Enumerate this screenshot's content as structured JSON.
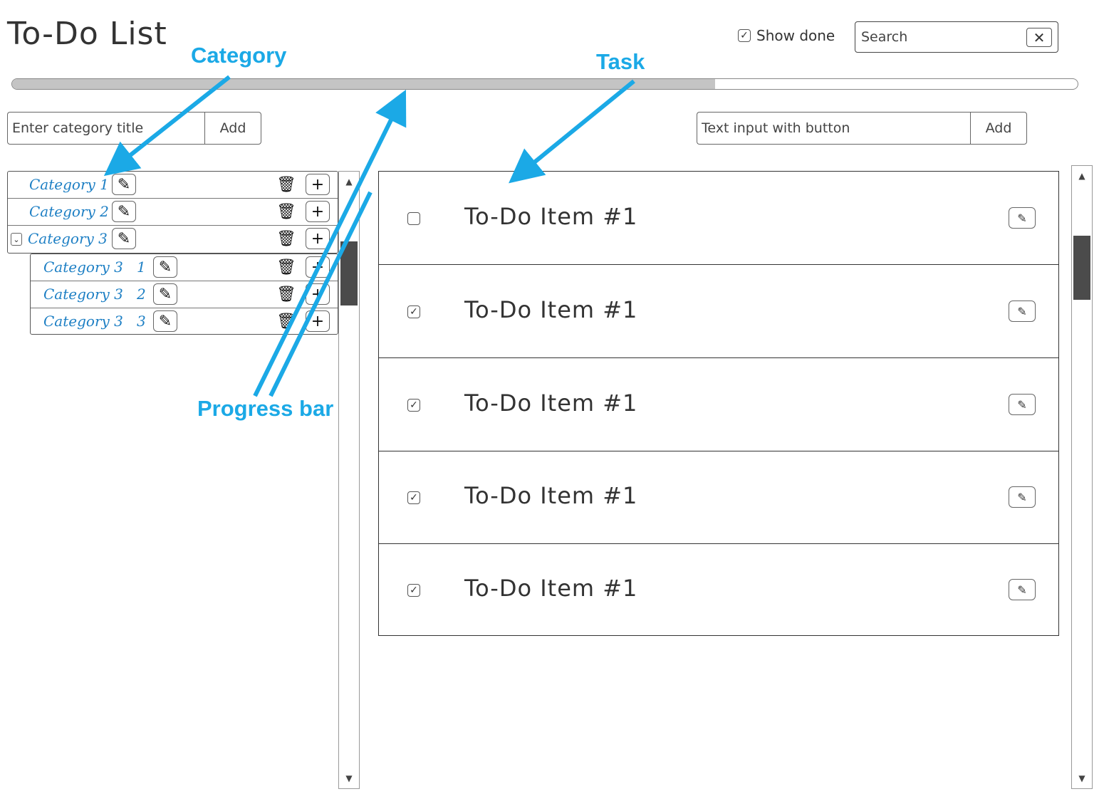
{
  "app": {
    "title": "To-Do List"
  },
  "header": {
    "show_done_label": "Show done",
    "show_done_checked": true,
    "search_placeholder": "Search",
    "search_clear_icon": "close-icon"
  },
  "progress": {
    "value_percent": 66
  },
  "category_input": {
    "placeholder": "Enter category title",
    "button_label": "Add"
  },
  "task_input": {
    "placeholder": "Text input with button",
    "button_label": "Add"
  },
  "categories": [
    {
      "label": "Category 1",
      "expanded": false
    },
    {
      "label": "Category 2",
      "expanded": false
    },
    {
      "label": "Category 3",
      "expanded": true
    }
  ],
  "subcategories": [
    {
      "label": "Category 3   1"
    },
    {
      "label": "Category 3   2"
    },
    {
      "label": "Category 3   3"
    }
  ],
  "tasks": [
    {
      "title": "To-Do Item #1",
      "done": false
    },
    {
      "title": "To-Do Item #1",
      "done": true
    },
    {
      "title": "To-Do Item #1",
      "done": true
    },
    {
      "title": "To-Do Item #1",
      "done": true
    },
    {
      "title": "To-Do Item #1",
      "done": true
    }
  ],
  "annotations": {
    "category": "Category",
    "task": "Task",
    "progress": "Progress bar",
    "color": "#1ba9e6"
  },
  "colors": {
    "category_text": "#1d7fc4",
    "progress_fill": "#c4c4c4",
    "scroll_thumb": "#4b4b4b"
  }
}
